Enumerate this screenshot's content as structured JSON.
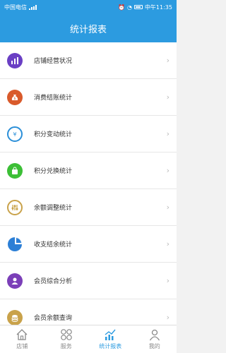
{
  "status": {
    "carrier": "中国电信",
    "time": "中午11:35"
  },
  "header": {
    "title": "统计报表"
  },
  "menu": [
    {
      "label": "店铺经营状况",
      "icon": "bar-chart-icon",
      "color": "#6a3fc4"
    },
    {
      "label": "消费结账统计",
      "icon": "money-bag-icon",
      "color": "#d95a2b"
    },
    {
      "label": "积分变动统计",
      "icon": "exchange-icon",
      "color": "#2b8fd8"
    },
    {
      "label": "积分兑换统计",
      "icon": "gift-bag-icon",
      "color": "#3cbf36"
    },
    {
      "label": "余额调整统计",
      "icon": "adjust-icon",
      "color": "#c9a24a"
    },
    {
      "label": "收支结余统计",
      "icon": "pie-chart-icon",
      "color": "#2c7fd6"
    },
    {
      "label": "会员综合分析",
      "icon": "member-icon",
      "color": "#7b3fb8"
    },
    {
      "label": "会员余额查询",
      "icon": "coins-icon",
      "color": "#c9a24a"
    }
  ],
  "tabs": [
    {
      "label": "店铺",
      "icon": "home-icon",
      "active": false
    },
    {
      "label": "服务",
      "icon": "grid-icon",
      "active": false
    },
    {
      "label": "统计报表",
      "icon": "trend-chart-icon",
      "active": true
    },
    {
      "label": "我的",
      "icon": "user-icon",
      "active": false
    }
  ]
}
